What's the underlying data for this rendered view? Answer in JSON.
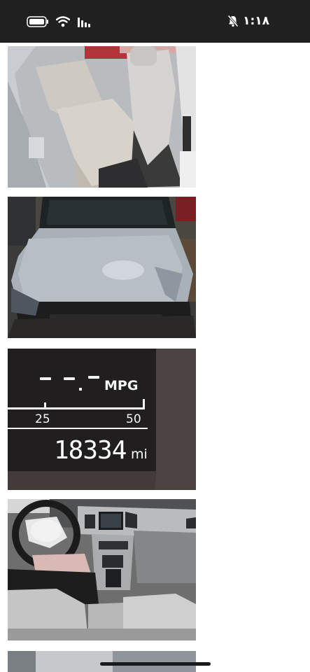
{
  "status_bar": {
    "time": "١:١٨",
    "icons": [
      "battery-icon",
      "wifi-icon",
      "signal-icon",
      "bell-muted-icon"
    ]
  },
  "photos": [
    {
      "subject": "rear seats interior"
    },
    {
      "subject": "damaged front hood"
    },
    {
      "subject": "odometer display",
      "mpg_dashes": "- -.-",
      "mpg_label": "MPG",
      "scale_low": "25",
      "scale_high": "50",
      "miles": "18334",
      "miles_unit": "mi"
    },
    {
      "subject": "dashboard with deployed airbag"
    },
    {
      "subject": "exterior partial"
    }
  ],
  "colors": {
    "status_bar_bg": "#202020",
    "page_bg": "#ffffff",
    "home_indicator": "#1a1a1a"
  }
}
